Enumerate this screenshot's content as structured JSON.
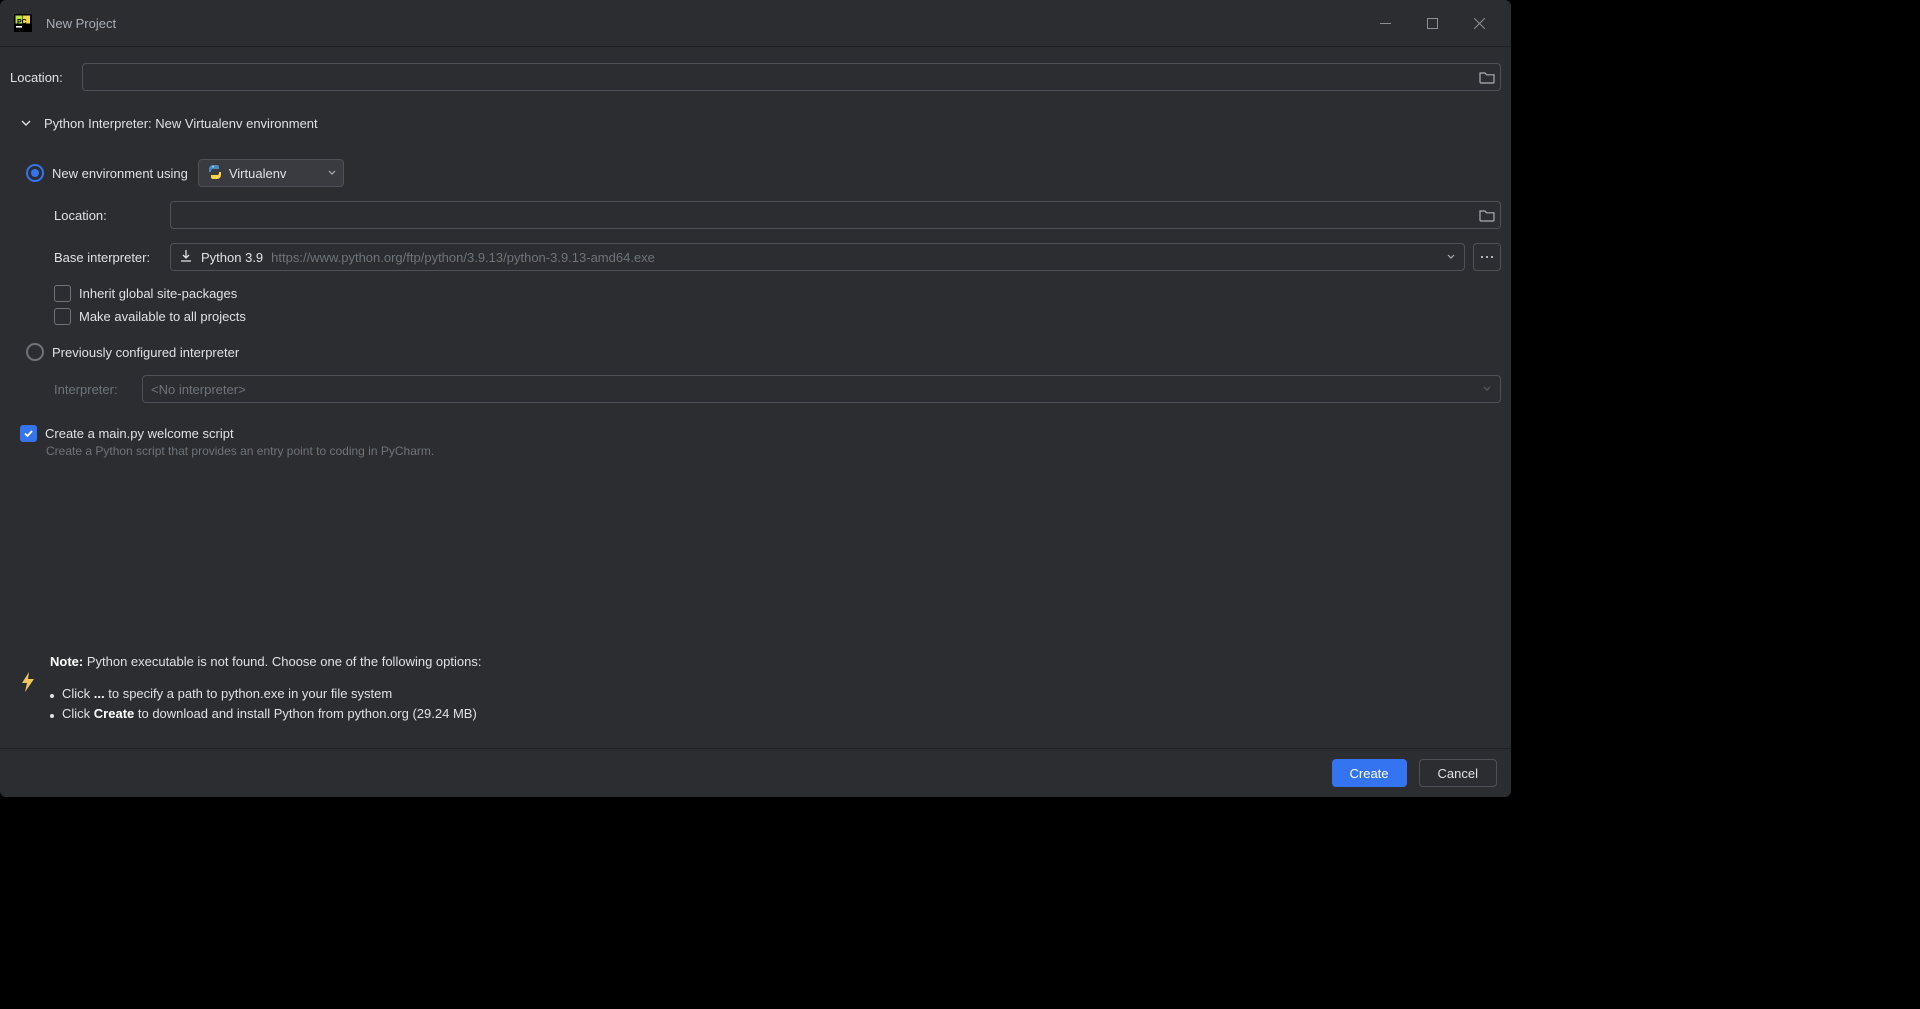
{
  "window": {
    "title": "New Project"
  },
  "location": {
    "label": "Location:",
    "value": ""
  },
  "interpreter_section": {
    "title_prefix": "Python Interpreter:",
    "title_value": "New Virtualenv environment"
  },
  "new_env": {
    "radio_label": "New environment using",
    "tool": "Virtualenv",
    "location_label": "Location:",
    "location_value": "",
    "base_label": "Base interpreter:",
    "base_name": "Python 3.9",
    "base_url": "https://www.python.org/ftp/python/3.9.13/python-3.9.13-amd64.exe",
    "inherit_label": "Inherit global site-packages",
    "make_avail_label": "Make available to all projects"
  },
  "previous": {
    "radio_label": "Previously configured interpreter",
    "interpreter_label": "Interpreter:",
    "value": "<No interpreter>"
  },
  "welcome": {
    "label": "Create a main.py welcome script",
    "hint": "Create a Python script that provides an entry point to coding in PyCharm."
  },
  "note": {
    "prefix": "Note:",
    "body": "Python executable is not found. Choose one of the following options:",
    "bullet1_pre": "Click ",
    "bullet1_bold": "...",
    "bullet1_post": " to specify a path to python.exe in your file system",
    "bullet2_pre": "Click ",
    "bullet2_bold": "Create",
    "bullet2_post": " to download and install Python from python.org (29.24 MB)"
  },
  "footer": {
    "create": "Create",
    "cancel": "Cancel"
  }
}
